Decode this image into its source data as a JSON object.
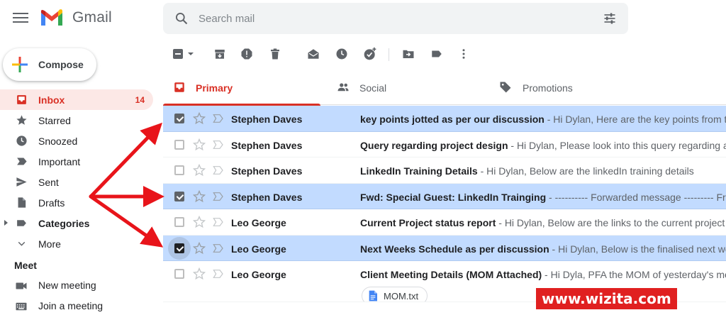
{
  "header": {
    "app_name": "Gmail",
    "search_placeholder": "Search mail"
  },
  "sidebar": {
    "compose_label": "Compose",
    "items": [
      {
        "label": "Inbox",
        "count": "14",
        "icon": "inbox-icon",
        "active": true
      },
      {
        "label": "Starred",
        "icon": "star-icon"
      },
      {
        "label": "Snoozed",
        "icon": "clock-icon"
      },
      {
        "label": "Important",
        "icon": "important-icon"
      },
      {
        "label": "Sent",
        "icon": "send-icon"
      },
      {
        "label": "Drafts",
        "icon": "draft-icon"
      },
      {
        "label": "Categories",
        "icon": "label-icon"
      },
      {
        "label": "More",
        "icon": "chevron-down-icon"
      }
    ],
    "meet": {
      "title": "Meet",
      "items": [
        {
          "label": "New meeting",
          "icon": "video-icon"
        },
        {
          "label": "Join a meeting",
          "icon": "keyboard-icon"
        }
      ]
    }
  },
  "tabs": [
    {
      "label": "Primary",
      "icon": "inbox-icon",
      "active": true
    },
    {
      "label": "Social",
      "icon": "people-icon"
    },
    {
      "label": "Promotions",
      "icon": "tag-icon"
    }
  ],
  "emails": [
    {
      "sender": "Stephen Daves",
      "subject": "key points jotted as per our discussion",
      "snippet": " - Hi Dylan, Here are the key points from the journal",
      "selected": true
    },
    {
      "sender": "Stephen Daves",
      "subject": "Query regarding project design",
      "snippet": " - Hi Dylan, Please look into this query regarding an issue in",
      "selected": false
    },
    {
      "sender": "Stephen Daves",
      "subject": "LinkedIn Training Details",
      "snippet": " - Hi Dylan, Below are the linkedIn training details",
      "selected": false
    },
    {
      "sender": "Stephen Daves",
      "subject": "Fwd: Special Guest: LinkedIn Trainging",
      "snippet": " - ---------- Forwarded message --------- From: Eric Lo",
      "selected": true
    },
    {
      "sender": "Leo George",
      "subject": "Current Project status report",
      "snippet": " - Hi Dylan, Below are the links to the current project status re",
      "selected": false
    },
    {
      "sender": "Leo George",
      "subject": "Next Weeks Schedule as per discussion",
      "snippet": " - Hi Dylan, Below is the finalised next week sche",
      "selected": true
    },
    {
      "sender": "Leo George",
      "subject": "Client Meeting Details (MOM Attached)",
      "snippet": " - Hi Dyla, PFA the MOM of yesterday's meeting w",
      "selected": false,
      "attachment": "MOM.txt"
    }
  ],
  "watermark": "www.wizita.com",
  "colors": {
    "accent_red": "#d93025",
    "selected_row": "#c2dbff",
    "arrow_red": "#e8141a"
  }
}
